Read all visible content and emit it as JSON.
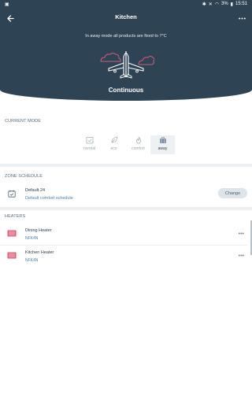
{
  "status_bar": {
    "battery": "3%",
    "time": "15:51"
  },
  "header": {
    "title": "Kitchen",
    "notice": "In away mode all products are fixed to 7°C",
    "mode_label": "Continuous"
  },
  "current_mode": {
    "section_title": "CURRENT MODE",
    "modes": [
      {
        "label": "normal",
        "icon": "calendar-check-icon",
        "active": false
      },
      {
        "label": "eco",
        "icon": "leaf-icon",
        "active": false
      },
      {
        "label": "comfort",
        "icon": "flame-icon",
        "active": false
      },
      {
        "label": "away",
        "icon": "suitcase-icon",
        "active": true
      }
    ]
  },
  "zone_schedule": {
    "section_title": "ZONE SCHEDULE",
    "name": "Default 24",
    "description": "Default comfort schedule",
    "change_label": "Change"
  },
  "heaters": {
    "section_title": "HEATERS",
    "items": [
      {
        "name": "Dining Heater",
        "model": "NFK4N"
      },
      {
        "name": "Kitchen Heater",
        "model": "NFK4N"
      }
    ]
  },
  "colors": {
    "header_bg": "#2e4354",
    "accent_link": "#4a7ea8",
    "heater_icon": "#e05a7a"
  }
}
